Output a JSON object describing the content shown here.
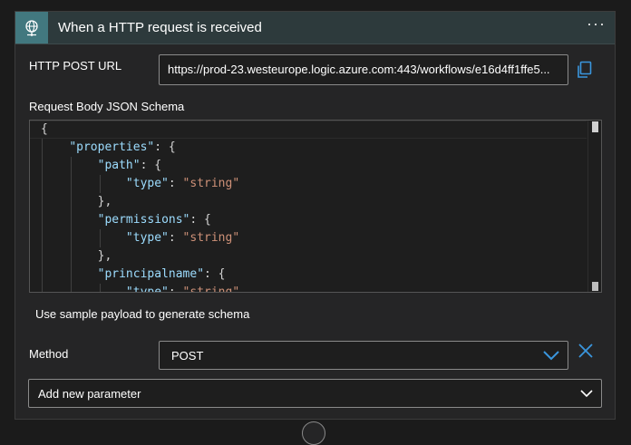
{
  "trigger": {
    "title": "When a HTTP request is received",
    "more_label": "···",
    "icon": "globe-network-icon"
  },
  "http_post_url": {
    "label": "HTTP POST URL",
    "value": "https://prod-23.westeurope.logic.azure.com:443/workflows/e16d4ff1ffe5...",
    "copy_icon": "copy-icon"
  },
  "schema": {
    "label": "Request Body JSON Schema",
    "lines": [
      {
        "indent": 0,
        "parts": [
          {
            "t": "p",
            "v": "{"
          }
        ]
      },
      {
        "indent": 1,
        "parts": [
          {
            "t": "k",
            "v": "\"properties\""
          },
          {
            "t": "p",
            "v": ": {"
          }
        ]
      },
      {
        "indent": 2,
        "parts": [
          {
            "t": "k",
            "v": "\"path\""
          },
          {
            "t": "p",
            "v": ": {"
          }
        ]
      },
      {
        "indent": 3,
        "parts": [
          {
            "t": "k",
            "v": "\"type\""
          },
          {
            "t": "p",
            "v": ": "
          },
          {
            "t": "s",
            "v": "\"string\""
          }
        ]
      },
      {
        "indent": 2,
        "parts": [
          {
            "t": "p",
            "v": "},"
          }
        ]
      },
      {
        "indent": 2,
        "parts": [
          {
            "t": "k",
            "v": "\"permissions\""
          },
          {
            "t": "p",
            "v": ": {"
          }
        ]
      },
      {
        "indent": 3,
        "parts": [
          {
            "t": "k",
            "v": "\"type\""
          },
          {
            "t": "p",
            "v": ": "
          },
          {
            "t": "s",
            "v": "\"string\""
          }
        ]
      },
      {
        "indent": 2,
        "parts": [
          {
            "t": "p",
            "v": "},"
          }
        ]
      },
      {
        "indent": 2,
        "parts": [
          {
            "t": "k",
            "v": "\"principalname\""
          },
          {
            "t": "p",
            "v": ": {"
          }
        ]
      },
      {
        "indent": 3,
        "parts": [
          {
            "t": "k",
            "v": "\"type\""
          },
          {
            "t": "p",
            "v": ": "
          },
          {
            "t": "s",
            "v": "\"string\""
          }
        ]
      }
    ]
  },
  "sample_payload_label": "Use sample payload to generate schema",
  "method": {
    "label": "Method",
    "value": "POST",
    "chevron_icon": "chevron-down-icon",
    "clear_icon": "close-icon"
  },
  "add_parameter": {
    "label": "Add new parameter",
    "chevron_icon": "chevron-down-icon"
  },
  "colors": {
    "key": "#9cdcfe",
    "string": "#ce9178",
    "accent": "#3a96dd",
    "header_icon_bg": "#42787f"
  }
}
